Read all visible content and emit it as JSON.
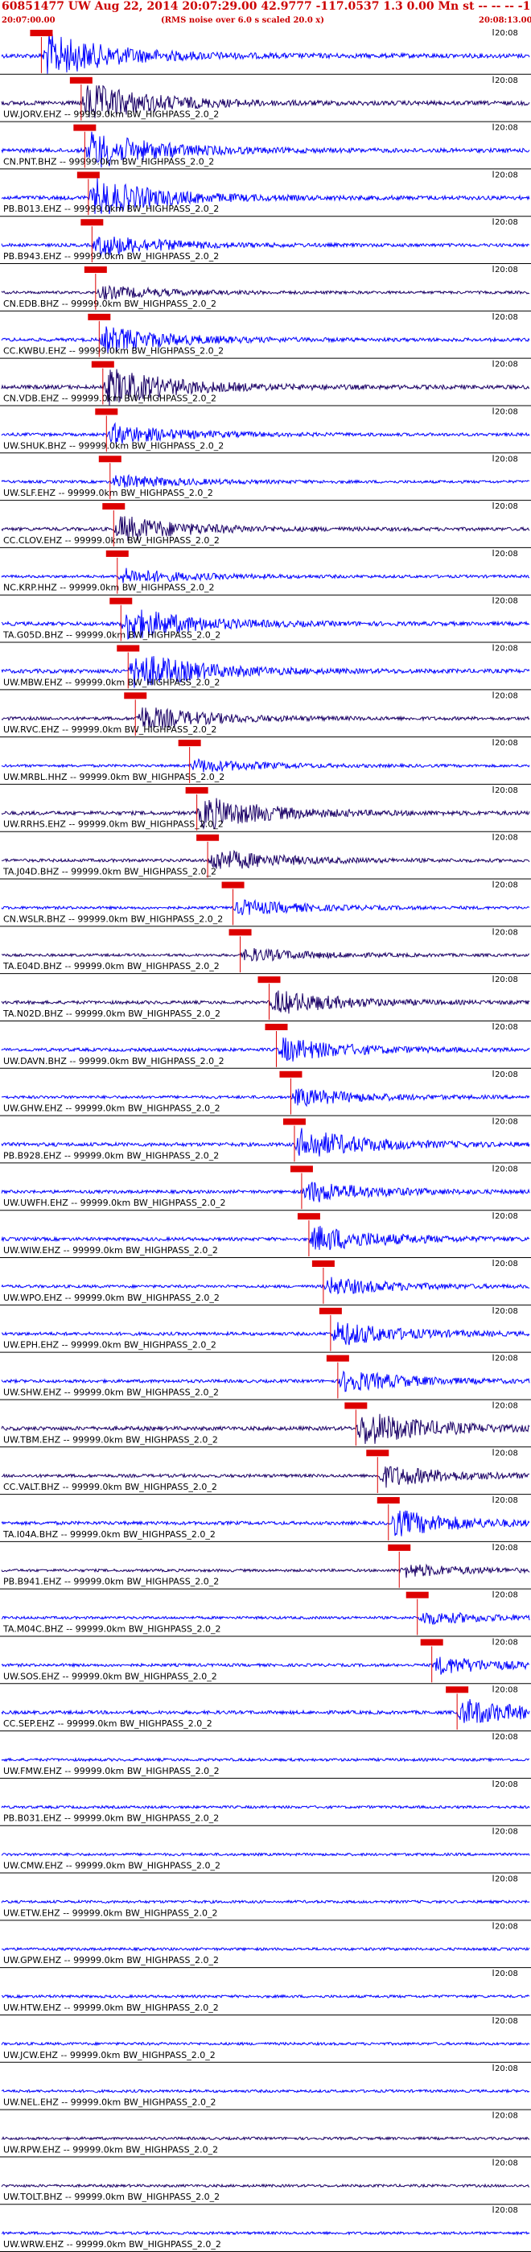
{
  "header": {
    "title": "60851477 UW Aug 22, 2014 20:07:29.00   42.9777 -117.0537  1.3 0.00 Mn st -- -- -- -1",
    "start_time": "20:07:00.00",
    "note": "(RMS noise over 6.0 s scaled 20.0 x)",
    "end_time": "20:08:13.00"
  },
  "colors": {
    "trace_blue": "#0000ff",
    "trace_navy": "#1a0066",
    "pick_red": "#dd0000",
    "label_text": "#000000",
    "header_red": "#cc0000"
  },
  "chart_data": {
    "type": "seismogram_record_section",
    "title": "60851477 UW Aug 22, 2014 20:07:29.00   42.9777 -117.0537  1.3 0.00 Mn st -- -- -- -1",
    "x_axis": {
      "start": "20:07:00.00",
      "end": "20:08:13.00",
      "minute_tick": "20:08"
    },
    "traces": [
      {
        "label": "",
        "color": "blue",
        "pick_time_s": 5.5,
        "amp": 1.0
      },
      {
        "label": "UW.JORV.EHZ -- 99999.0km BW_HIGHPASS_2.0_2",
        "color": "navy",
        "pick_time_s": 11.0,
        "amp": 0.9
      },
      {
        "label": "CN.PNT.BHZ -- 99999.0km BW_HIGHPASS_2.0_2",
        "color": "blue",
        "pick_time_s": 11.5,
        "amp": 0.85
      },
      {
        "label": "PB.B013.EHZ -- 99999.0km BW_HIGHPASS_2.0_2",
        "color": "blue",
        "pick_time_s": 12.0,
        "amp": 0.85
      },
      {
        "label": "PB.B943.EHZ -- 99999.0km BW_HIGHPASS_2.0_2",
        "color": "blue",
        "pick_time_s": 12.5,
        "amp": 0.5
      },
      {
        "label": "CN.EDB.BHZ -- 99999.0km BW_HIGHPASS_2.0_2",
        "color": "navy",
        "pick_time_s": 13.0,
        "amp": 0.3
      },
      {
        "label": "CC.KWBU.EHZ -- 99999.0km BW_HIGHPASS_2.0_2",
        "color": "blue",
        "pick_time_s": 13.5,
        "amp": 0.6
      },
      {
        "label": "CN.VDB.EHZ -- 99999.0km BW_HIGHPASS_2.0_2",
        "color": "navy",
        "pick_time_s": 14.0,
        "amp": 0.85
      },
      {
        "label": "UW.SHUK.BHZ -- 99999.0km BW_HIGHPASS_2.0_2",
        "color": "blue",
        "pick_time_s": 14.5,
        "amp": 0.45
      },
      {
        "label": "UW.SLF.EHZ -- 99999.0km BW_HIGHPASS_2.0_2",
        "color": "blue",
        "pick_time_s": 15.0,
        "amp": 0.3
      },
      {
        "label": "CC.CLOV.EHZ -- 99999.0km BW_HIGHPASS_2.0_2",
        "color": "navy",
        "pick_time_s": 15.5,
        "amp": 0.6
      },
      {
        "label": "NC.KRP.HHZ -- 99999.0km BW_HIGHPASS_2.0_2",
        "color": "blue",
        "pick_time_s": 16.0,
        "amp": 0.35
      },
      {
        "label": "TA.G05D.BHZ -- 99999.0km BW_HIGHPASS_2.0_2",
        "color": "blue",
        "pick_time_s": 16.5,
        "amp": 0.75
      },
      {
        "label": "UW.MBW.EHZ -- 99999.0km BW_HIGHPASS_2.0_2",
        "color": "blue",
        "pick_time_s": 17.5,
        "amp": 0.85
      },
      {
        "label": "UW.RVC.EHZ -- 99999.0km BW_HIGHPASS_2.0_2",
        "color": "navy",
        "pick_time_s": 18.5,
        "amp": 0.55
      },
      {
        "label": "UW.MRBL.HHZ -- 99999.0km BW_HIGHPASS_2.0_2",
        "color": "blue",
        "pick_time_s": 26.0,
        "amp": 0.3
      },
      {
        "label": "UW.RRHS.EHZ -- 99999.0km BW_HIGHPASS_2.0_2",
        "color": "navy",
        "pick_time_s": 27.0,
        "amp": 0.75
      },
      {
        "label": "TA.J04D.BHZ -- 99999.0km BW_HIGHPASS_2.0_2",
        "color": "navy",
        "pick_time_s": 28.5,
        "amp": 0.5
      },
      {
        "label": "CN.WSLR.BHZ -- 99999.0km BW_HIGHPASS_2.0_2",
        "color": "blue",
        "pick_time_s": 32.0,
        "amp": 0.35
      },
      {
        "label": "TA.E04D.BHZ -- 99999.0km BW_HIGHPASS_2.0_2",
        "color": "navy",
        "pick_time_s": 33.0,
        "amp": 0.3
      },
      {
        "label": "TA.N02D.BHZ -- 99999.0km BW_HIGHPASS_2.0_2",
        "color": "navy",
        "pick_time_s": 37.0,
        "amp": 0.55
      },
      {
        "label": "UW.DAVN.BHZ -- 99999.0km BW_HIGHPASS_2.0_2",
        "color": "blue",
        "pick_time_s": 38.0,
        "amp": 0.55
      },
      {
        "label": "UW.GHW.EHZ -- 99999.0km BW_HIGHPASS_2.0_2",
        "color": "blue",
        "pick_time_s": 40.0,
        "amp": 0.4
      },
      {
        "label": "PB.B928.EHZ -- 99999.0km BW_HIGHPASS_2.0_2",
        "color": "blue",
        "pick_time_s": 40.5,
        "amp": 0.7
      },
      {
        "label": "UW.UWFH.EHZ -- 99999.0km BW_HIGHPASS_2.0_2",
        "color": "blue",
        "pick_time_s": 41.5,
        "amp": 0.5
      },
      {
        "label": "UW.WIW.EHZ -- 99999.0km BW_HIGHPASS_2.0_2",
        "color": "blue",
        "pick_time_s": 42.5,
        "amp": 0.6
      },
      {
        "label": "UW.WPO.EHZ -- 99999.0km BW_HIGHPASS_2.0_2",
        "color": "blue",
        "pick_time_s": 44.5,
        "amp": 0.4
      },
      {
        "label": "UW.EPH.EHZ -- 99999.0km BW_HIGHPASS_2.0_2",
        "color": "blue",
        "pick_time_s": 45.5,
        "amp": 0.55
      },
      {
        "label": "UW.SHW.EHZ -- 99999.0km BW_HIGHPASS_2.0_2",
        "color": "blue",
        "pick_time_s": 46.5,
        "amp": 0.5
      },
      {
        "label": "UW.TBM.EHZ -- 99999.0km BW_HIGHPASS_2.0_2",
        "color": "navy",
        "pick_time_s": 49.0,
        "amp": 0.8
      },
      {
        "label": "CC.VALT.BHZ -- 99999.0km BW_HIGHPASS_2.0_2",
        "color": "navy",
        "pick_time_s": 52.0,
        "amp": 0.5
      },
      {
        "label": "TA.I04A.BHZ -- 99999.0km BW_HIGHPASS_2.0_2",
        "color": "blue",
        "pick_time_s": 53.5,
        "amp": 0.6
      },
      {
        "label": "PB.B941.EHZ -- 99999.0km BW_HIGHPASS_2.0_2",
        "color": "navy",
        "pick_time_s": 55.0,
        "amp": 0.3
      },
      {
        "label": "TA.M04C.BHZ -- 99999.0km BW_HIGHPASS_2.0_2",
        "color": "blue",
        "pick_time_s": 57.5,
        "amp": 0.3
      },
      {
        "label": "UW.SOS.EHZ -- 99999.0km BW_HIGHPASS_2.0_2",
        "color": "blue",
        "pick_time_s": 59.5,
        "amp": 0.4
      },
      {
        "label": "CC.SEP.EHZ -- 99999.0km BW_HIGHPASS_2.0_2",
        "color": "blue",
        "pick_time_s": 63.0,
        "amp": 0.6
      },
      {
        "label": "UW.FMW.EHZ -- 99999.0km BW_HIGHPASS_2.0_2",
        "color": "blue",
        "pick_time_s": null,
        "amp": 0.35
      },
      {
        "label": "PB.B031.EHZ -- 99999.0km BW_HIGHPASS_2.0_2",
        "color": "blue",
        "pick_time_s": null,
        "amp": 0.3
      },
      {
        "label": "UW.CMW.EHZ -- 99999.0km BW_HIGHPASS_2.0_2",
        "color": "blue",
        "pick_time_s": null,
        "amp": 0.3
      },
      {
        "label": "UW.ETW.EHZ -- 99999.0km BW_HIGHPASS_2.0_2",
        "color": "blue",
        "pick_time_s": null,
        "amp": 0.3
      },
      {
        "label": "UW.GPW.EHZ -- 99999.0km BW_HIGHPASS_2.0_2",
        "color": "blue",
        "pick_time_s": null,
        "amp": 0.3
      },
      {
        "label": "UW.HTW.EHZ -- 99999.0km BW_HIGHPASS_2.0_2",
        "color": "blue",
        "pick_time_s": null,
        "amp": 0.3
      },
      {
        "label": "UW.JCW.EHZ -- 99999.0km BW_HIGHPASS_2.0_2",
        "color": "blue",
        "pick_time_s": null,
        "amp": 0.3
      },
      {
        "label": "UW.NEL.EHZ -- 99999.0km BW_HIGHPASS_2.0_2",
        "color": "blue",
        "pick_time_s": null,
        "amp": 0.3
      },
      {
        "label": "UW.RPW.EHZ -- 99999.0km BW_HIGHPASS_2.0_2",
        "color": "navy",
        "pick_time_s": null,
        "amp": 0.3
      },
      {
        "label": "UW.TOLT.BHZ -- 99999.0km BW_HIGHPASS_2.0_2",
        "color": "navy",
        "pick_time_s": null,
        "amp": 0.3
      },
      {
        "label": "UW.WRW.EHZ -- 99999.0km BW_HIGHPASS_2.0_2",
        "color": "blue",
        "pick_time_s": null,
        "amp": 0.3
      }
    ]
  }
}
